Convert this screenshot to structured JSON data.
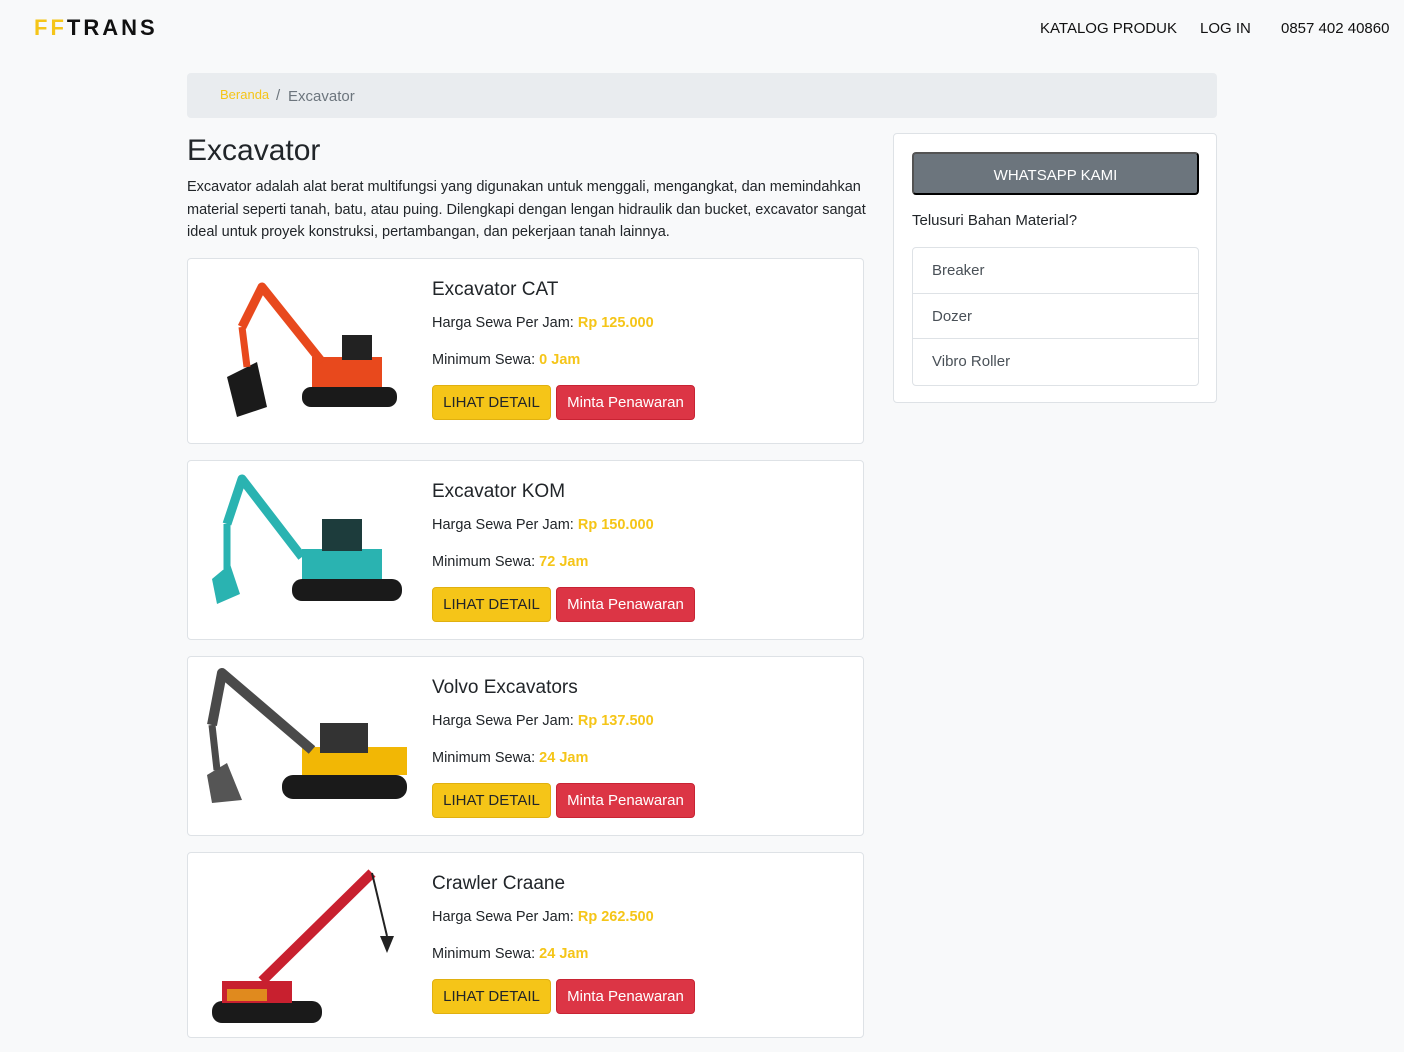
{
  "brand": {
    "prefix": "FF",
    "name": "TRANS"
  },
  "nav": {
    "catalog": "KATALOG PRODUK",
    "login": "LOG IN",
    "phone": "0857 402 40860"
  },
  "breadcrumb": {
    "home": "Beranda",
    "separator": "/",
    "current": "Excavator"
  },
  "page": {
    "title": "Excavator",
    "description": "Excavator adalah alat berat multifungsi yang digunakan untuk menggali, mengangkat, dan memindahkan material seperti tanah, batu, atau puing. Dilengkapi dengan lengan hidraulik dan bucket, excavator sangat ideal untuk proyek konstruksi, pertambangan, dan pekerjaan tanah lainnya."
  },
  "products": [
    {
      "name": "Excavator CAT",
      "price_label": "Harga Sewa Per Jam:",
      "price": "Rp 125.000",
      "min_label": "Minimum Sewa:",
      "min": "0 Jam",
      "detail": "LIHAT DETAIL",
      "offer": "Minta Penawaran",
      "color": "#e8491d"
    },
    {
      "name": "Excavator KOM",
      "price_label": "Harga Sewa Per Jam:",
      "price": "Rp 150.000",
      "min_label": "Minimum Sewa:",
      "min": "72 Jam",
      "detail": "LIHAT DETAIL",
      "offer": "Minta Penawaran",
      "color": "#2ab3b1"
    },
    {
      "name": "Volvo Excavators",
      "price_label": "Harga Sewa Per Jam:",
      "price": "Rp 137.500",
      "min_label": "Minimum Sewa:",
      "min": "24 Jam",
      "detail": "LIHAT DETAIL",
      "offer": "Minta Penawaran",
      "color": "#4a4a4a"
    },
    {
      "name": "Crawler Craane",
      "price_label": "Harga Sewa Per Jam:",
      "price": "Rp 262.500",
      "min_label": "Minimum Sewa:",
      "min": "24 Jam",
      "detail": "LIHAT DETAIL",
      "offer": "Minta Penawaran",
      "color": "#c8202f"
    }
  ],
  "sidebar": {
    "whatsapp": "WHATSAPP KAMI",
    "question": "Telusuri Bahan Material?",
    "items": [
      "Breaker",
      "Dozer",
      "Vibro Roller"
    ]
  },
  "colors": {
    "accent": "#f5c518",
    "danger": "#dc3545",
    "secondary": "#6c757d"
  }
}
